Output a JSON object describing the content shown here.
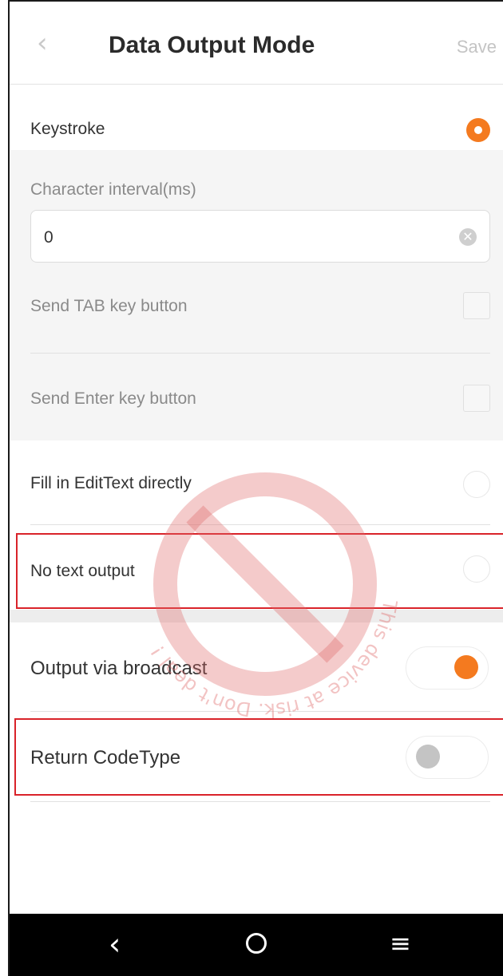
{
  "header": {
    "back_icon": "chevron-left-icon",
    "title": "Data Output Mode",
    "save_label": "Save"
  },
  "keystroke": {
    "label": "Keystroke",
    "selected": true
  },
  "keystroke_options": {
    "char_interval_label": "Character interval(ms)",
    "char_interval_value": "0",
    "send_tab_label": "Send TAB key button",
    "send_tab_checked": false,
    "send_enter_label": "Send Enter key button",
    "send_enter_checked": false
  },
  "fill_edittext": {
    "label": "Fill in EditText directly",
    "selected": false
  },
  "no_text_output": {
    "label": "No text output",
    "selected": false
  },
  "broadcast": {
    "label": "Output via broadcast",
    "on": true
  },
  "return_codetype": {
    "label": "Return CodeType",
    "on": false
  },
  "watermark": {
    "text": "This device at risk. Don't deal !"
  },
  "colors": {
    "accent": "#f47a1f",
    "highlight": "#d9232a",
    "watermark": "#e06a6a"
  },
  "navbar": {
    "back_icon": "back-icon",
    "home_icon": "home-icon",
    "menu_icon": "menu-icon"
  }
}
